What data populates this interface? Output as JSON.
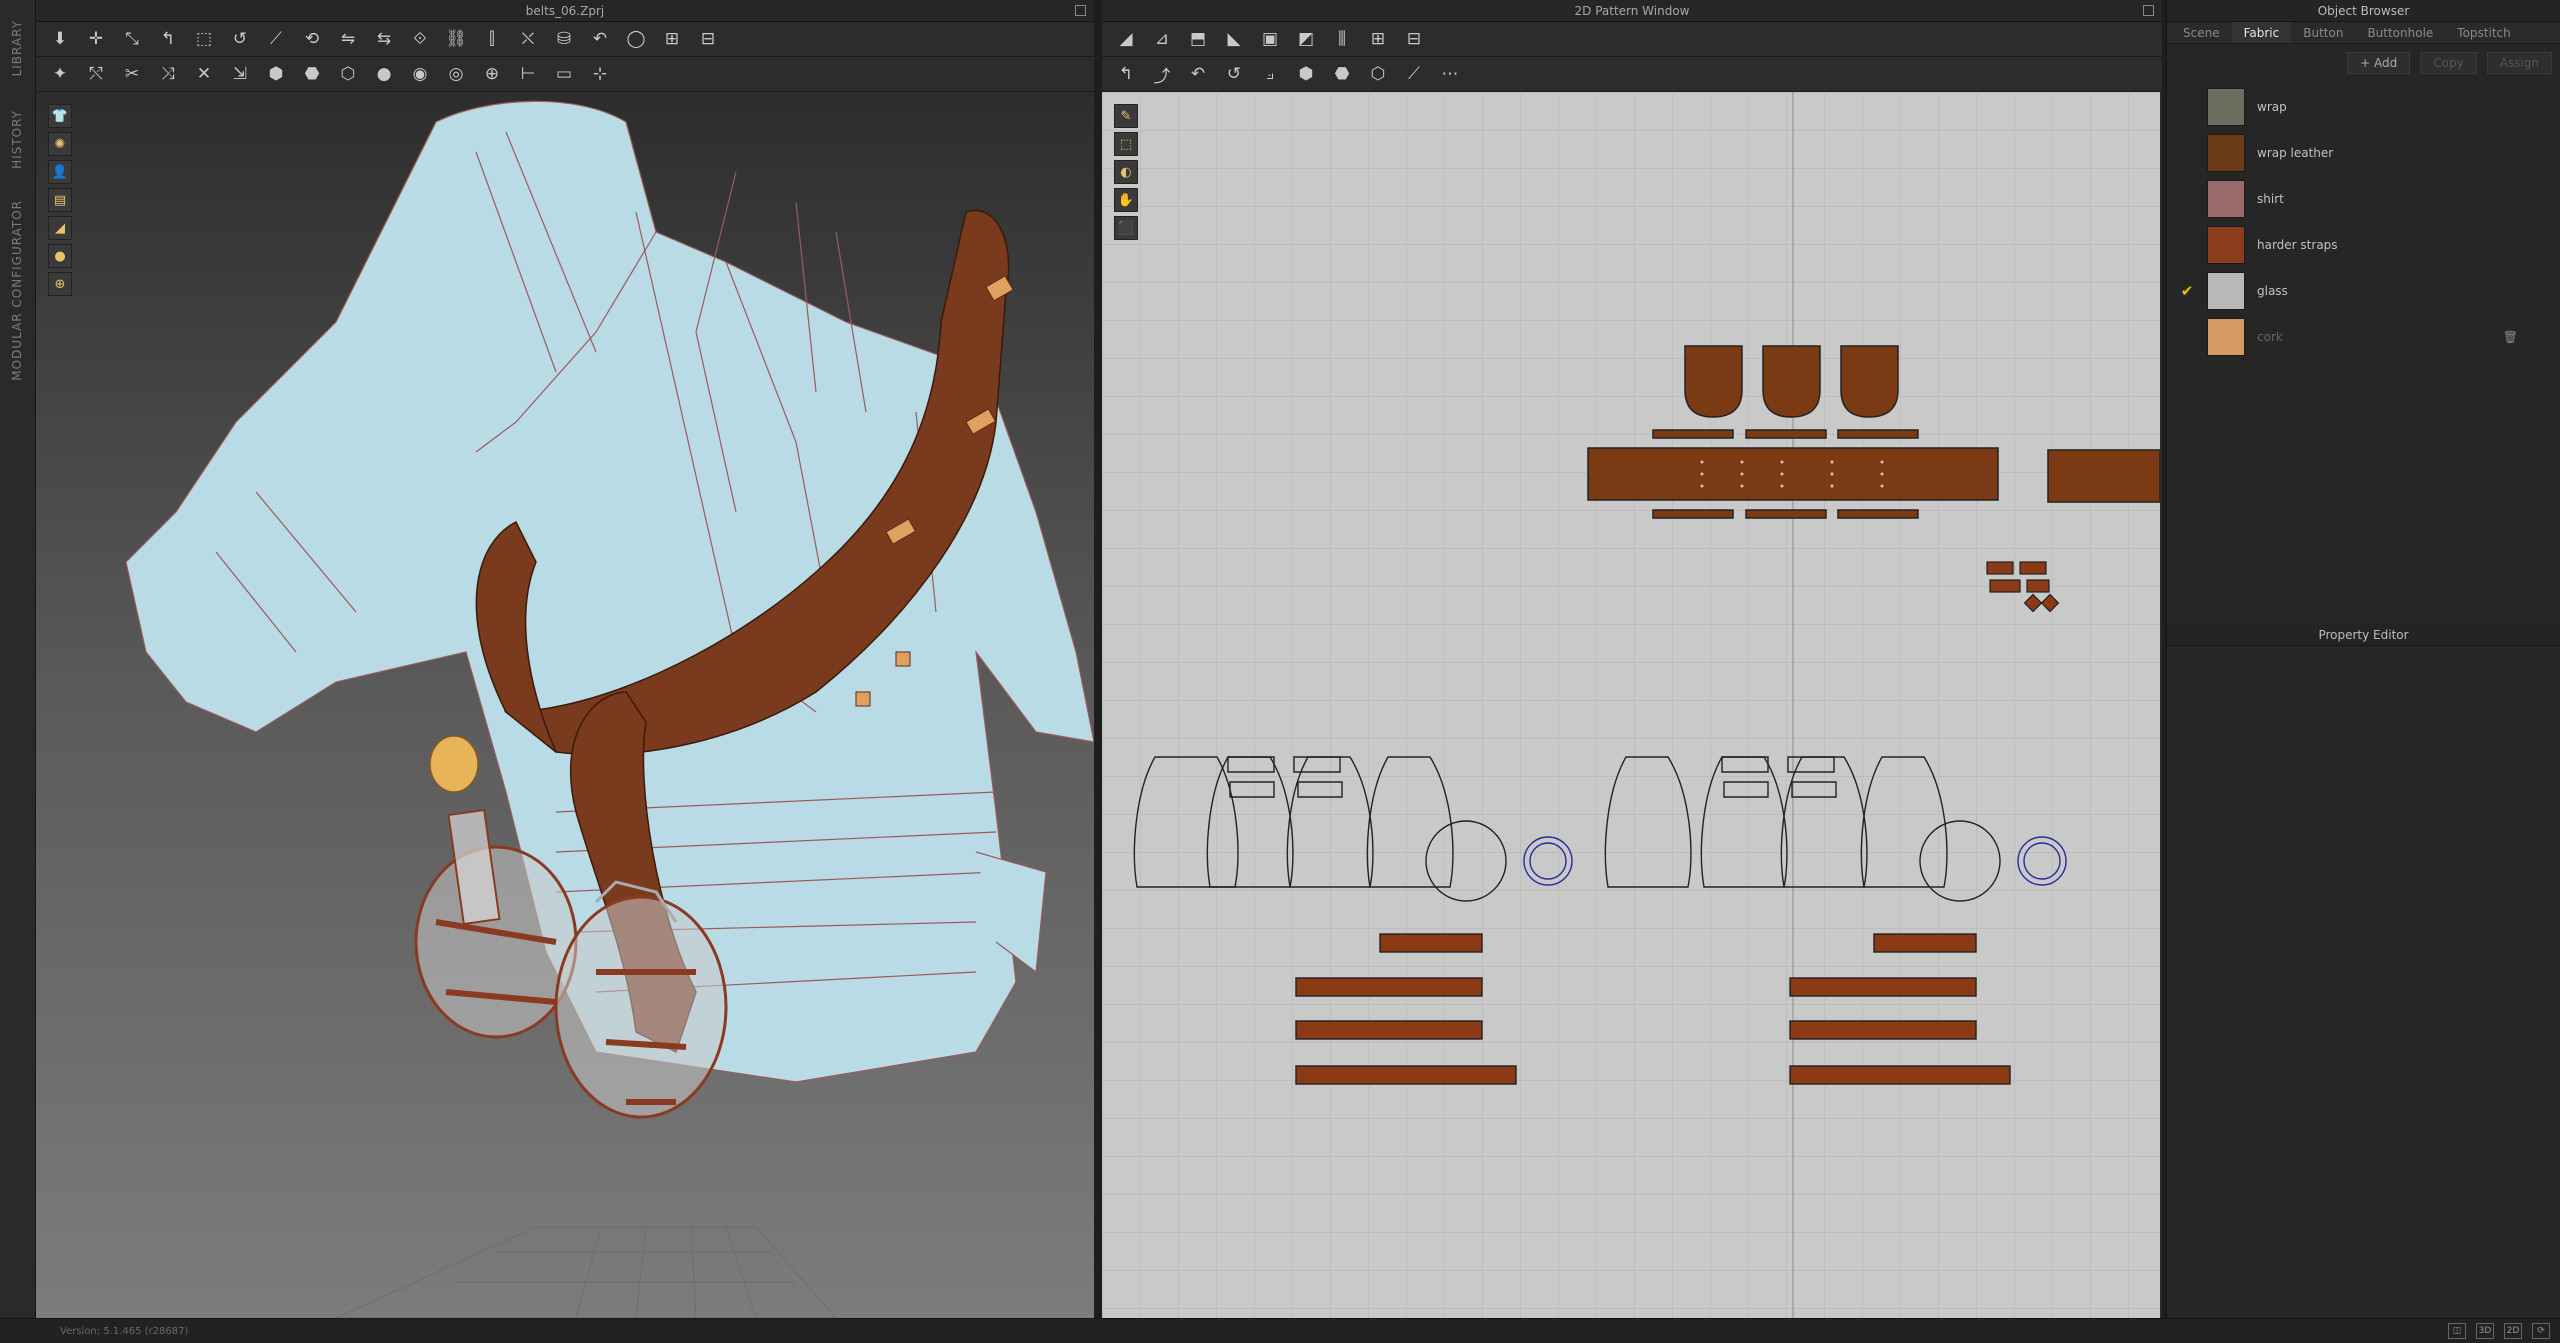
{
  "app": {
    "left_strip_labels": [
      "LIBRARY",
      "HISTORY",
      "MODULAR CONFIGURATOR"
    ],
    "status_version": "Version: 5.1.465 (r28687)",
    "status_buttons": [
      "◫",
      "3D",
      "2D",
      "⟳"
    ]
  },
  "window3d": {
    "title": "belts_06.Zprj",
    "toolbar_row1": [
      "⬇",
      "✛",
      "⤡",
      "↰",
      "⬚",
      "↺",
      "⟋",
      "⟲",
      "⇋",
      "⇆",
      "⟐",
      "⛓",
      "⫿",
      "⛌",
      "⛁",
      "↶",
      "◯",
      "⊞",
      "⊟"
    ],
    "toolbar_row2": [
      "✦",
      "⤲",
      "✂",
      "⤨",
      "✕",
      "⇲",
      "⬢",
      "⬣",
      "⬡",
      "●",
      "◉",
      "◎",
      "⊕",
      "⊢",
      "▭",
      "⊹"
    ],
    "view_tools": [
      "👕",
      "✺",
      "👤",
      "▤",
      "◢",
      "●",
      "⊕"
    ]
  },
  "window2d": {
    "title": "2D Pattern Window",
    "toolbar_row1": [
      "◢",
      "⊿",
      "⬒",
      "◣",
      "▣",
      "◩",
      "⫼",
      "⊞",
      "⊟"
    ],
    "toolbar_row2": [
      "↰",
      "⤴",
      "↶",
      "↺",
      "⟓",
      "⬢",
      "⬣",
      "⬡",
      "⟋",
      "⋯"
    ],
    "view_tools": [
      "✎",
      "⬚",
      "◐",
      "✋",
      "⬛"
    ]
  },
  "object_browser": {
    "title": "Object Browser",
    "tabs": [
      "Scene",
      "Fabric",
      "Button",
      "Buttonhole",
      "Topstitch"
    ],
    "active_tab": "Fabric",
    "buttons": {
      "add": "+ Add",
      "copy": "Copy",
      "assign": "Assign"
    },
    "fabrics": [
      {
        "name": "wrap",
        "color": "#6b6e5e",
        "checked": false,
        "dim": false
      },
      {
        "name": "wrap leather",
        "color": "#6a3a16",
        "checked": false,
        "dim": false
      },
      {
        "name": "shirt",
        "color": "#9a6a6a",
        "checked": false,
        "dim": false
      },
      {
        "name": "harder straps",
        "color": "#8a3e1e",
        "checked": false,
        "dim": false
      },
      {
        "name": "glass",
        "color": "#b8b8b8",
        "checked": true,
        "dim": false
      },
      {
        "name": "cork",
        "color": "#d49a64",
        "checked": false,
        "dim": true
      }
    ]
  },
  "property_editor": {
    "title": "Property Editor"
  }
}
